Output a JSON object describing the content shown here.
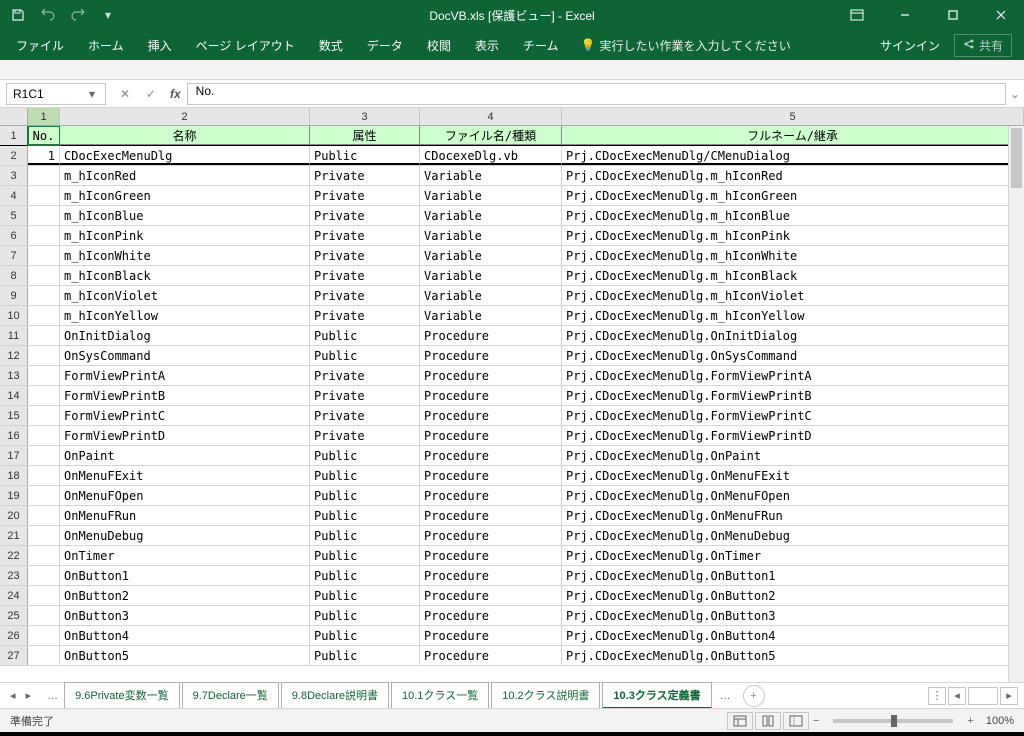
{
  "title": "DocVB.xls  [保護ビュー] - Excel",
  "qat": {
    "save": "save-icon",
    "undo": "undo-icon",
    "redo": "redo-icon",
    "custom": "customize-qat"
  },
  "ribbon": [
    "ファイル",
    "ホーム",
    "挿入",
    "ページ レイアウト",
    "数式",
    "データ",
    "校閲",
    "表示",
    "チーム"
  ],
  "tellme": "実行したい作業を入力してください",
  "signin": "サインイン",
  "share": "共有",
  "namebox": "R1C1",
  "formula": "No.",
  "cols": [
    "1",
    "2",
    "3",
    "4",
    "5"
  ],
  "headers": [
    "No.",
    "名称",
    "属性",
    "ファイル名/種類",
    "フルネーム/継承"
  ],
  "rows": [
    {
      "n": "1",
      "no": "1",
      "name": "CDocExecMenuDlg",
      "attr": "Public",
      "file": "CDocexeDlg.vb",
      "full": "Prj.CDocExecMenuDlg/CMenuDialog"
    },
    {
      "n": "2",
      "no": "",
      "name": "m_hIconRed",
      "attr": "Private",
      "file": "Variable",
      "full": "Prj.CDocExecMenuDlg.m_hIconRed"
    },
    {
      "n": "3",
      "no": "",
      "name": "m_hIconGreen",
      "attr": "Private",
      "file": "Variable",
      "full": "Prj.CDocExecMenuDlg.m_hIconGreen"
    },
    {
      "n": "4",
      "no": "",
      "name": "m_hIconBlue",
      "attr": "Private",
      "file": "Variable",
      "full": "Prj.CDocExecMenuDlg.m_hIconBlue"
    },
    {
      "n": "5",
      "no": "",
      "name": "m_hIconPink",
      "attr": "Private",
      "file": "Variable",
      "full": "Prj.CDocExecMenuDlg.m_hIconPink"
    },
    {
      "n": "6",
      "no": "",
      "name": "m_hIconWhite",
      "attr": "Private",
      "file": "Variable",
      "full": "Prj.CDocExecMenuDlg.m_hIconWhite"
    },
    {
      "n": "7",
      "no": "",
      "name": "m_hIconBlack",
      "attr": "Private",
      "file": "Variable",
      "full": "Prj.CDocExecMenuDlg.m_hIconBlack"
    },
    {
      "n": "8",
      "no": "",
      "name": "m_hIconViolet",
      "attr": "Private",
      "file": "Variable",
      "full": "Prj.CDocExecMenuDlg.m_hIconViolet"
    },
    {
      "n": "9",
      "no": "",
      "name": "m_hIconYellow",
      "attr": "Private",
      "file": "Variable",
      "full": "Prj.CDocExecMenuDlg.m_hIconYellow"
    },
    {
      "n": "10",
      "no": "",
      "name": "OnInitDialog",
      "attr": "Public",
      "file": "Procedure",
      "full": "Prj.CDocExecMenuDlg.OnInitDialog"
    },
    {
      "n": "11",
      "no": "",
      "name": "OnSysCommand",
      "attr": "Public",
      "file": "Procedure",
      "full": "Prj.CDocExecMenuDlg.OnSysCommand"
    },
    {
      "n": "12",
      "no": "",
      "name": "FormViewPrintA",
      "attr": "Private",
      "file": "Procedure",
      "full": "Prj.CDocExecMenuDlg.FormViewPrintA"
    },
    {
      "n": "13",
      "no": "",
      "name": "FormViewPrintB",
      "attr": "Private",
      "file": "Procedure",
      "full": "Prj.CDocExecMenuDlg.FormViewPrintB"
    },
    {
      "n": "14",
      "no": "",
      "name": "FormViewPrintC",
      "attr": "Private",
      "file": "Procedure",
      "full": "Prj.CDocExecMenuDlg.FormViewPrintC"
    },
    {
      "n": "15",
      "no": "",
      "name": "FormViewPrintD",
      "attr": "Private",
      "file": "Procedure",
      "full": "Prj.CDocExecMenuDlg.FormViewPrintD"
    },
    {
      "n": "16",
      "no": "",
      "name": "OnPaint",
      "attr": "Public",
      "file": "Procedure",
      "full": "Prj.CDocExecMenuDlg.OnPaint"
    },
    {
      "n": "17",
      "no": "",
      "name": "OnMenuFExit",
      "attr": "Public",
      "file": "Procedure",
      "full": "Prj.CDocExecMenuDlg.OnMenuFExit"
    },
    {
      "n": "18",
      "no": "",
      "name": "OnMenuFOpen",
      "attr": "Public",
      "file": "Procedure",
      "full": "Prj.CDocExecMenuDlg.OnMenuFOpen"
    },
    {
      "n": "19",
      "no": "",
      "name": "OnMenuFRun",
      "attr": "Public",
      "file": "Procedure",
      "full": "Prj.CDocExecMenuDlg.OnMenuFRun"
    },
    {
      "n": "20",
      "no": "",
      "name": "OnMenuDebug",
      "attr": "Public",
      "file": "Procedure",
      "full": "Prj.CDocExecMenuDlg.OnMenuDebug"
    },
    {
      "n": "21",
      "no": "",
      "name": "OnTimer",
      "attr": "Public",
      "file": "Procedure",
      "full": "Prj.CDocExecMenuDlg.OnTimer"
    },
    {
      "n": "22",
      "no": "",
      "name": "OnButton1",
      "attr": "Public",
      "file": "Procedure",
      "full": "Prj.CDocExecMenuDlg.OnButton1"
    },
    {
      "n": "23",
      "no": "",
      "name": "OnButton2",
      "attr": "Public",
      "file": "Procedure",
      "full": "Prj.CDocExecMenuDlg.OnButton2"
    },
    {
      "n": "24",
      "no": "",
      "name": "OnButton3",
      "attr": "Public",
      "file": "Procedure",
      "full": "Prj.CDocExecMenuDlg.OnButton3"
    },
    {
      "n": "25",
      "no": "",
      "name": "OnButton4",
      "attr": "Public",
      "file": "Procedure",
      "full": "Prj.CDocExecMenuDlg.OnButton4"
    },
    {
      "n": "26",
      "no": "",
      "name": "OnButton5",
      "attr": "Public",
      "file": "Procedure",
      "full": "Prj.CDocExecMenuDlg.OnButton5"
    }
  ],
  "sheettabs": [
    "9.6Private変数一覧",
    "9.7Declare一覧",
    "9.8Declare説明書",
    "10.1クラス一覧",
    "10.2クラス説明書",
    "10.3クラス定義書"
  ],
  "active_tab": 5,
  "status": "準備完了",
  "zoom": "100%"
}
